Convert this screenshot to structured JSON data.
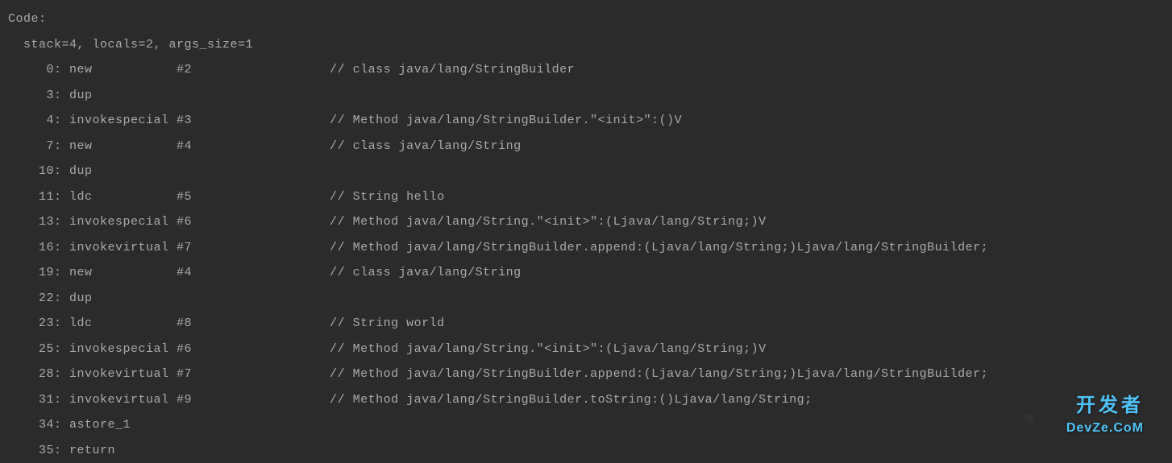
{
  "header": {
    "label": "Code:",
    "meta": "  stack=4, locals=2, args_size=1"
  },
  "lines": [
    {
      "text": "     0: new           #2                  // class java/lang/StringBuilder"
    },
    {
      "text": "     3: dup"
    },
    {
      "text": "     4: invokespecial #3                  // Method java/lang/StringBuilder.\"<init>\":()V"
    },
    {
      "text": "     7: new           #4                  // class java/lang/String"
    },
    {
      "text": "    10: dup"
    },
    {
      "text": "    11: ldc           #5                  // String hello"
    },
    {
      "text": "    13: invokespecial #6                  // Method java/lang/String.\"<init>\":(Ljava/lang/String;)V"
    },
    {
      "text": "    16: invokevirtual #7                  // Method java/lang/StringBuilder.append:(Ljava/lang/String;)Ljava/lang/StringBuilder;"
    },
    {
      "text": "    19: new           #4                  // class java/lang/String"
    },
    {
      "text": "    22: dup"
    },
    {
      "text": "    23: ldc           #8                  // String world"
    },
    {
      "text": "    25: invokespecial #6                  // Method java/lang/String.\"<init>\":(Ljava/lang/String;)V"
    },
    {
      "text": "    28: invokevirtual #7                  // Method java/lang/StringBuilder.append:(Ljava/lang/String;)Ljava/lang/StringBuilder;"
    },
    {
      "text": "    31: invokevirtual #9                  // Method java/lang/StringBuilder.toString:()Ljava/lang/String;"
    },
    {
      "text": "    34: astore_1"
    },
    {
      "text": "    35: return"
    }
  ],
  "watermark": {
    "cn": "开发者",
    "en": "DevZe.CoM",
    "faint": "@"
  }
}
